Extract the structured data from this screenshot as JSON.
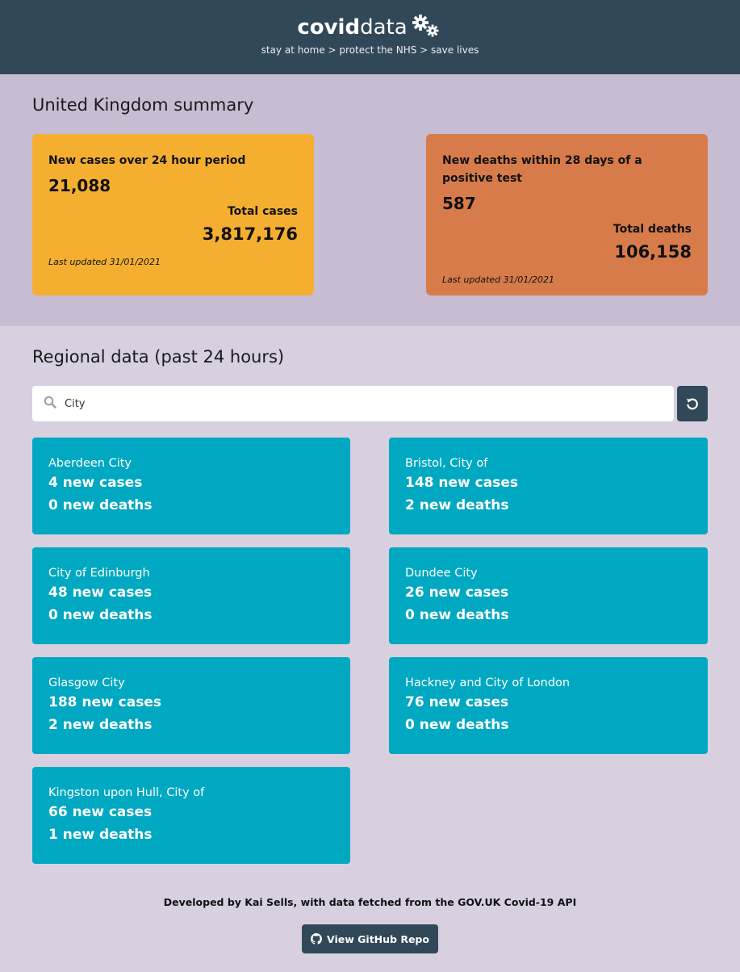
{
  "header": {
    "brand_bold": "covid",
    "brand_light": "data",
    "tagline": "stay at home > protect the NHS > save lives"
  },
  "summary": {
    "title": "United Kingdom summary",
    "cases": {
      "label": "New cases over 24 hour period",
      "value": "21,088",
      "total_label": "Total cases",
      "total_value": "3,817,176",
      "updated": "Last updated 31/01/2021",
      "color": "#f5af30"
    },
    "deaths": {
      "label": "New deaths within 28 days of a positive test",
      "value": "587",
      "total_label": "Total deaths",
      "total_value": "106,158",
      "updated": "Last updated 31/01/2021",
      "color": "#d77b4a"
    }
  },
  "regional": {
    "title": "Regional data (past 24 hours)",
    "search_value": "City",
    "regions": [
      {
        "name": "Aberdeen City",
        "cases": "4 new cases",
        "deaths": "0 new deaths"
      },
      {
        "name": "Bristol, City of",
        "cases": "148 new cases",
        "deaths": "2 new deaths"
      },
      {
        "name": "City of Edinburgh",
        "cases": "48 new cases",
        "deaths": "0 new deaths"
      },
      {
        "name": "Dundee City",
        "cases": "26 new cases",
        "deaths": "0 new deaths"
      },
      {
        "name": "Glasgow City",
        "cases": "188 new cases",
        "deaths": "2 new deaths"
      },
      {
        "name": "Hackney and City of London",
        "cases": "76 new cases",
        "deaths": "0 new deaths"
      },
      {
        "name": "Kingston upon Hull, City of",
        "cases": "66 new cases",
        "deaths": "1 new deaths"
      }
    ]
  },
  "footer": {
    "text_1": "Developed by ",
    "author": "Kai Sells",
    "text_2": ", with data fetched from the ",
    "source": "GOV.UK Covid-19 API",
    "button_label": "View GitHub Repo"
  },
  "icons": [
    "gears-icon",
    "search-icon",
    "reset-icon",
    "github-icon"
  ],
  "colors": {
    "header": "#314858",
    "region_card": "#00a8c2"
  }
}
